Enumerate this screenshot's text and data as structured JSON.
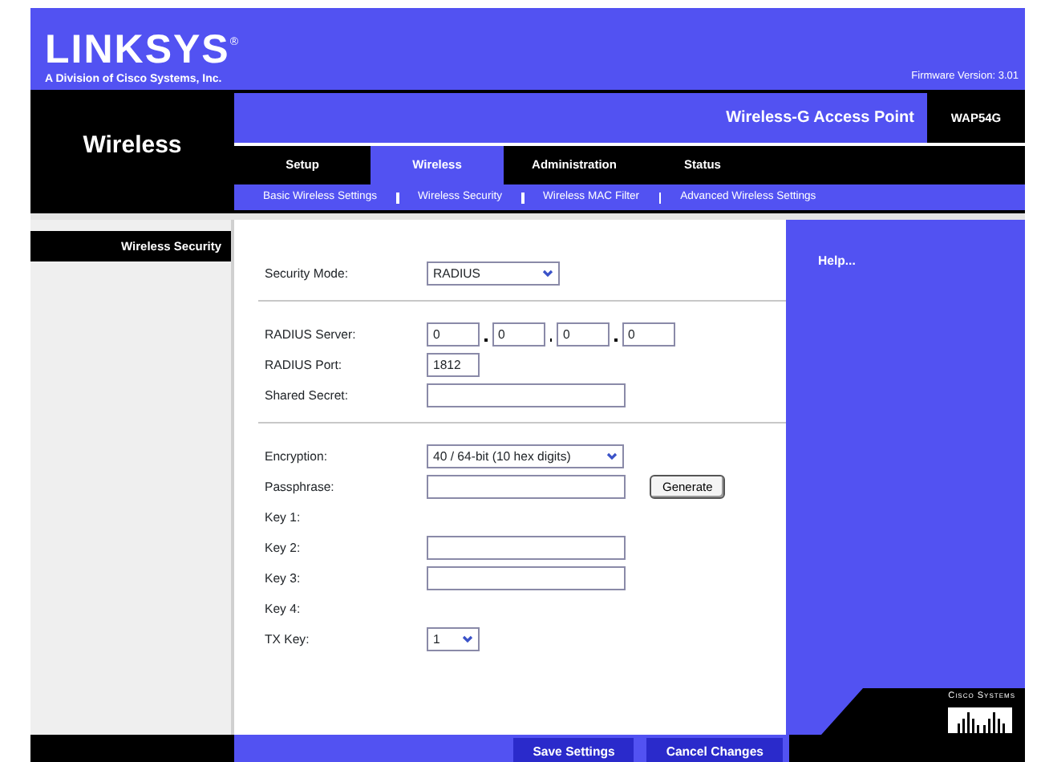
{
  "header": {
    "logo": "LINKSYS",
    "logo_mark": "®",
    "subtitle": "A Division of Cisco Systems, Inc.",
    "firmware": "Firmware Version: 3.01"
  },
  "section_title": "Wireless",
  "product": "Wireless-G Access Point",
  "model": "WAP54G",
  "tabs": [
    {
      "label": "Setup",
      "selected": false
    },
    {
      "label": "Wireless",
      "selected": true
    },
    {
      "label": "Administration",
      "selected": false
    },
    {
      "label": "Status",
      "selected": false
    }
  ],
  "subtabs": [
    {
      "label": "Basic Wireless Settings"
    },
    {
      "label": "Wireless Security"
    },
    {
      "label": "Wireless MAC Filter"
    },
    {
      "label": "Advanced Wireless Settings"
    }
  ],
  "sidebar": {
    "heading": "Wireless Security"
  },
  "form": {
    "groups": [
      {
        "rows": [
          {
            "kind": "select",
            "label": "Security Mode:",
            "value": "RADIUS"
          }
        ]
      },
      {
        "rows": [
          {
            "kind": "ip",
            "label": "RADIUS Server:",
            "values": [
              "0",
              "0",
              "0",
              "0"
            ]
          },
          {
            "kind": "short",
            "label": "RADIUS Port:",
            "value": "1812"
          },
          {
            "kind": "text",
            "label": "Shared Secret:"
          }
        ]
      },
      {
        "rows": [
          {
            "kind": "wideselect",
            "label": "Encryption:",
            "value": "40 / 64-bit (10 hex digits)"
          },
          {
            "kind": "text",
            "label": "Passphrase:",
            "button": "Generate"
          },
          {
            "kind": "label",
            "label": "Key 1:"
          },
          {
            "kind": "text",
            "label": "Key 2:"
          },
          {
            "kind": "text",
            "label": "Key 3:"
          },
          {
            "kind": "label",
            "label": "Key 4:"
          },
          {
            "kind": "tinyselect",
            "label": "TX Key:",
            "value": "1"
          }
        ]
      }
    ]
  },
  "help": {
    "title": "Help..."
  },
  "footer": {
    "buttons": [
      "Save Settings",
      "Cancel Changes"
    ],
    "brand": "Cisco Systems"
  }
}
